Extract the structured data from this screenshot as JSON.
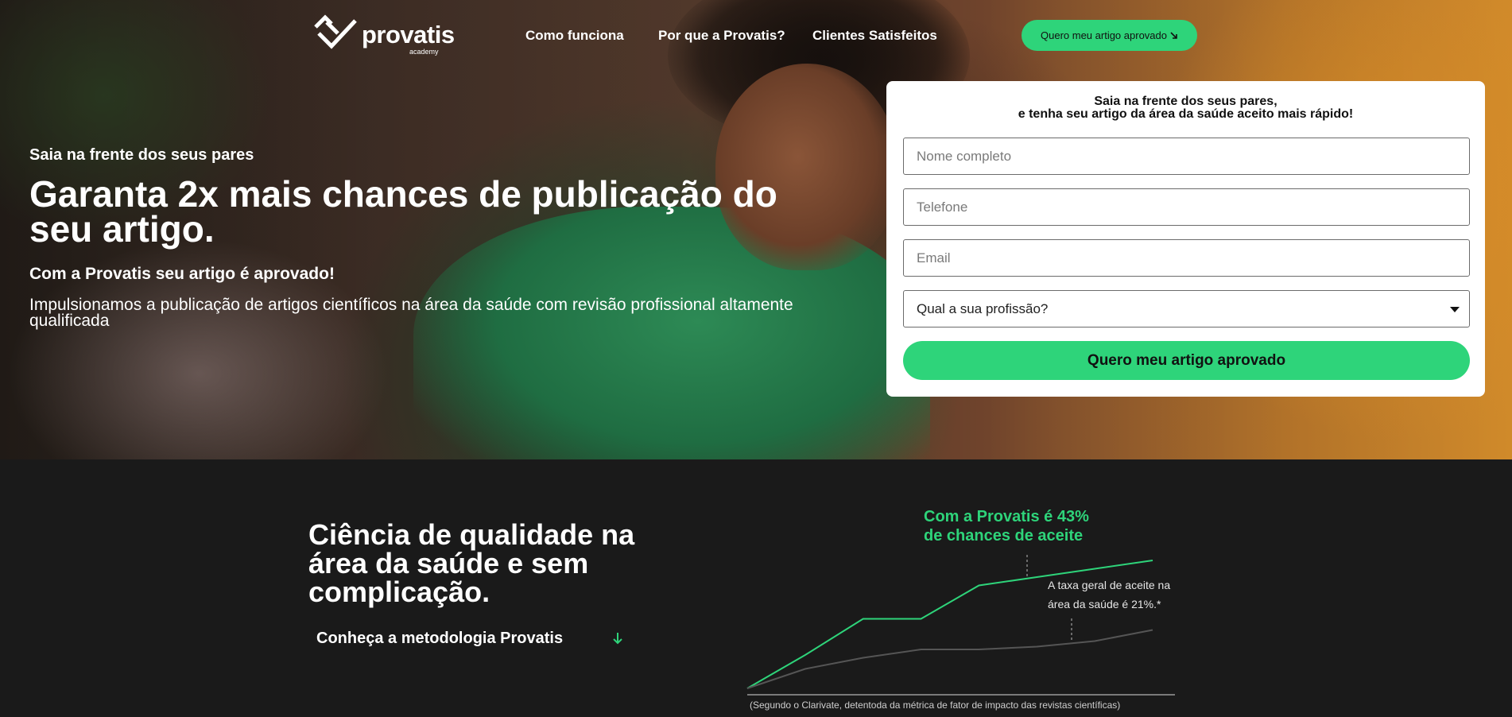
{
  "brand": {
    "name": "provatis",
    "tagline": "academy",
    "accent": "#2ed47a",
    "dark_bg": "#1a1a1a"
  },
  "nav": {
    "items": [
      "Como funciona",
      "Por que a Provatis?",
      "Clientes Satisfeitos"
    ],
    "cta_label": "Quero meu artigo aprovado",
    "cta_icon": "arrow-down-right-icon"
  },
  "hero": {
    "eyebrow": "Saia na frente dos seus pares",
    "headline": "Garanta 2x mais chances de publicação do seu artigo.",
    "subheadline": "Com a Provatis seu artigo é aprovado!",
    "description": "Impulsionamos a publicação de artigos científicos na área da saúde com revisão profissional altamente qualificada"
  },
  "form": {
    "title_line1": "Saia na frente dos seus pares,",
    "title_line2": "e tenha seu artigo da área da saúde aceito mais rápido!",
    "name_placeholder": "Nome completo",
    "phone_placeholder": "Telefone",
    "email_placeholder": "Email",
    "profession_selected": "Qual a sua profissão?",
    "submit_label": "Quero meu artigo aprovado"
  },
  "section": {
    "title": "Ciência de qualidade na área da saúde e sem complicação.",
    "link_label": "Conheça a metodologia Provatis",
    "link_icon": "arrow-down-icon"
  },
  "chart_data": {
    "type": "line",
    "title": "",
    "series": [
      {
        "name": "Com a Provatis é 43% de chances de aceite",
        "color": "#2ed47a",
        "values": [
          0,
          12,
          25,
          25,
          37,
          40,
          43,
          46
        ]
      },
      {
        "name": "A taxa geral de aceite na área da saúde é 21%.*",
        "color": "#555555",
        "values": [
          0,
          7,
          11,
          14,
          14,
          15,
          17,
          21
        ]
      }
    ],
    "green_label_line1": "Com a Provatis é 43%",
    "green_label_line2": "de chances de aceite",
    "grey_label_line1": "A taxa geral de aceite na",
    "grey_label_line2": "área da saúde é 21%.*",
    "footnote": "(Segundo o Clarivate, detentoda da métrica de fator de impacto das revistas científicas)"
  }
}
